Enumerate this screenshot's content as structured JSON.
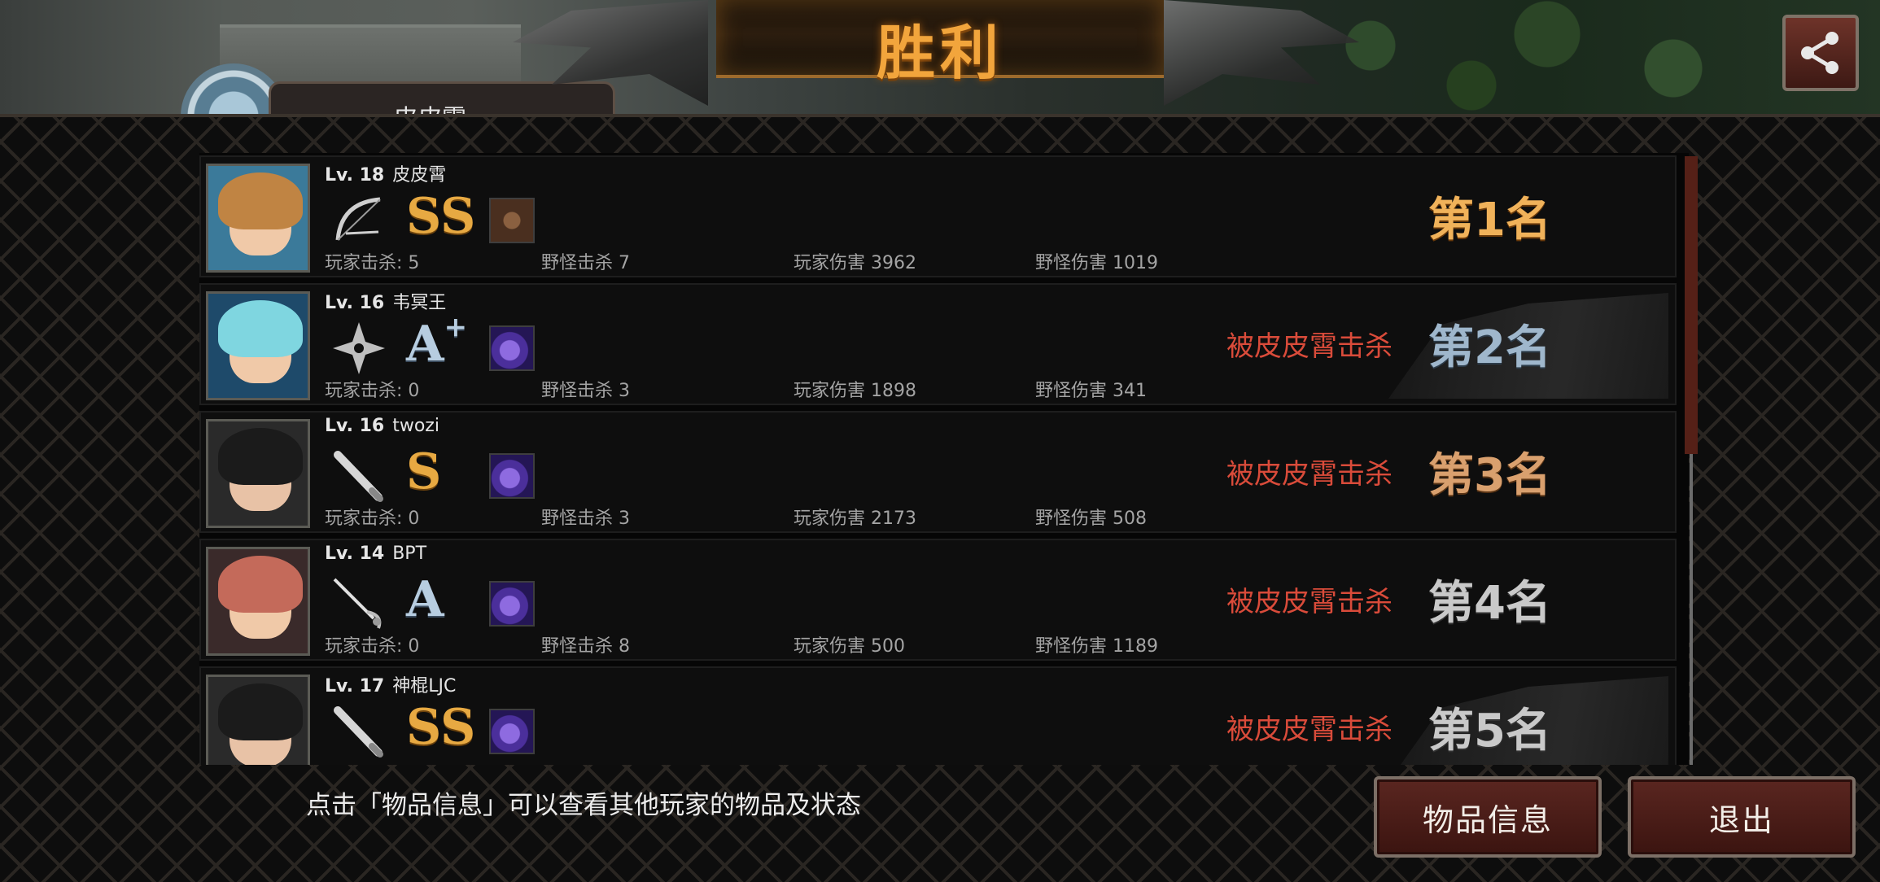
{
  "header": {
    "title": "胜利",
    "player_tab_name": "皮皮霄"
  },
  "players": [
    {
      "level": "Lv. 18",
      "name": "皮皮霄",
      "weapon": "bow-icon",
      "grade": "SS",
      "grade_suffix": "",
      "item": "brown-item-icon",
      "kill_players": "玩家击杀: 5",
      "kill_monsters": "野怪击杀 7",
      "damage_players": "玩家伤害 3962",
      "damage_monsters": "野怪伤害 1019",
      "killed_by": "",
      "rank": "第1名"
    },
    {
      "level": "Lv. 16",
      "name": "韦冥王",
      "weapon": "shuriken-icon",
      "grade": "A",
      "grade_suffix": "+",
      "item": "purple-item-icon",
      "kill_players": "玩家击杀: 0",
      "kill_monsters": "野怪击杀 3",
      "damage_players": "玩家伤害 1898",
      "damage_monsters": "野怪伤害 341",
      "killed_by": "被皮皮霄击杀",
      "rank": "第2名"
    },
    {
      "level": "Lv. 16",
      "name": "twozi",
      "weapon": "baseball-bat-icon",
      "grade": "S",
      "grade_suffix": "",
      "item": "purple-item-icon",
      "kill_players": "玩家击杀: 0",
      "kill_monsters": "野怪击杀 3",
      "damage_players": "玩家伤害 2173",
      "damage_monsters": "野怪伤害 508",
      "killed_by": "被皮皮霄击杀",
      "rank": "第3名"
    },
    {
      "level": "Lv. 14",
      "name": "BPT",
      "weapon": "rapier-icon",
      "grade": "A",
      "grade_suffix": "",
      "item": "purple-item-icon",
      "kill_players": "玩家击杀: 0",
      "kill_monsters": "野怪击杀 8",
      "damage_players": "玩家伤害 500",
      "damage_monsters": "野怪伤害 1189",
      "killed_by": "被皮皮霄击杀",
      "rank": "第4名"
    },
    {
      "level": "Lv. 17",
      "name": "神棍LJC",
      "weapon": "baseball-bat-icon",
      "grade": "SS",
      "grade_suffix": "",
      "item": "purple-item-icon",
      "kill_players": "",
      "kill_monsters": "",
      "damage_players": "",
      "damage_monsters": "",
      "killed_by": "被皮皮霄击杀",
      "rank": "第5名"
    }
  ],
  "footer": {
    "hint": "点击「物品信息」可以查看其他玩家的物品及状态",
    "item_info_label": "物品信息",
    "exit_label": "退出"
  },
  "colors": {
    "rank1": "#f0b25a",
    "rank2": "#9fb7cc",
    "rank3": "#d9a06e",
    "rank4": "#c9c9c9",
    "rank5": "#c9c9c9",
    "killed": "#d94b3a"
  }
}
